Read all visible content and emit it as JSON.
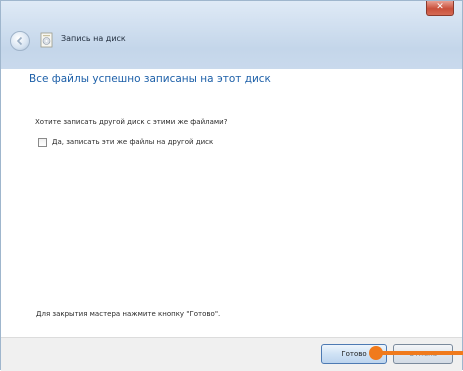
{
  "window": {
    "title": "Запись на диск",
    "close_glyph": "✕"
  },
  "content": {
    "heading": "Все файлы успешно записаны на этот диск",
    "question": "Хотите записать другой диск с этими же файлами?",
    "checkbox_label": "Да, записать эти же файлы на другой диск",
    "checkbox_checked": false,
    "footer_note": "Для закрытия мастера нажмите кнопку \"Готово\"."
  },
  "buttons": {
    "done_label": "Готово",
    "cancel_label": "Отмена"
  },
  "colors": {
    "heading": "#1c5fa8",
    "pointer": "#f07a1c"
  },
  "icons": {
    "back": "back-arrow-icon",
    "disc": "disc-burner-icon",
    "close": "close-icon"
  }
}
